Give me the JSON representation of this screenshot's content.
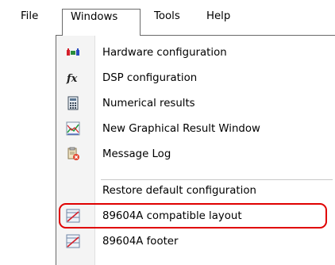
{
  "menubar": {
    "file": "File",
    "windows": "Windows",
    "tools": "Tools",
    "help": "Help"
  },
  "windows_menu": {
    "items": [
      {
        "label": "Hardware configuration",
        "icon": "hardware-config-icon"
      },
      {
        "label": "DSP configuration",
        "icon": "fx-function-icon"
      },
      {
        "label": "Numerical results",
        "icon": "calculator-icon"
      },
      {
        "label": "New Graphical Result Window",
        "icon": "graph-window-icon"
      },
      {
        "label": "Message Log",
        "icon": "message-log-icon"
      },
      {
        "label": "Restore default configuration",
        "icon": ""
      },
      {
        "label": "89604A compatible layout",
        "icon": "layout-icon"
      },
      {
        "label": "89604A footer",
        "icon": "layout-icon"
      }
    ],
    "highlighted_item": "89604A compatible layout",
    "highlight_color": "#e00000"
  }
}
